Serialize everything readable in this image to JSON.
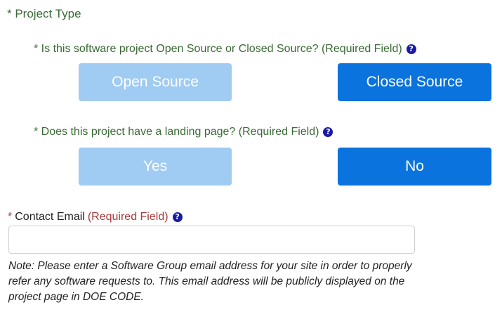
{
  "project_type": {
    "title": "* Project Type"
  },
  "open_closed_question": {
    "label": "* Is this software project Open Source or Closed Source? (Required Field)",
    "help_icon": "question-circle-icon",
    "options": [
      {
        "label": "Open Source",
        "selected": false
      },
      {
        "label": "Closed Source",
        "selected": true
      }
    ]
  },
  "landing_page_question": {
    "label": "* Does this project have a landing page? (Required Field)",
    "help_icon": "question-circle-icon",
    "options": [
      {
        "label": "Yes",
        "selected": false
      },
      {
        "label": "No",
        "selected": true
      }
    ]
  },
  "contact_email": {
    "asterisk": "*",
    "label": "Contact Email",
    "required_text": "(Required Field)",
    "help_icon": "question-circle-icon",
    "value": "",
    "placeholder": ""
  },
  "note": "Note: Please enter a Software Group email address for your site in order to properly refer any software requests to. This email address will be publicly displayed on the project page in DOE CODE.",
  "colors": {
    "green_label": "#3a6b35",
    "required_red": "#a73a3a",
    "button_selected": "#0b73dd",
    "button_unselected": "#a0cbf2",
    "help_icon": "#1a1aa8"
  }
}
